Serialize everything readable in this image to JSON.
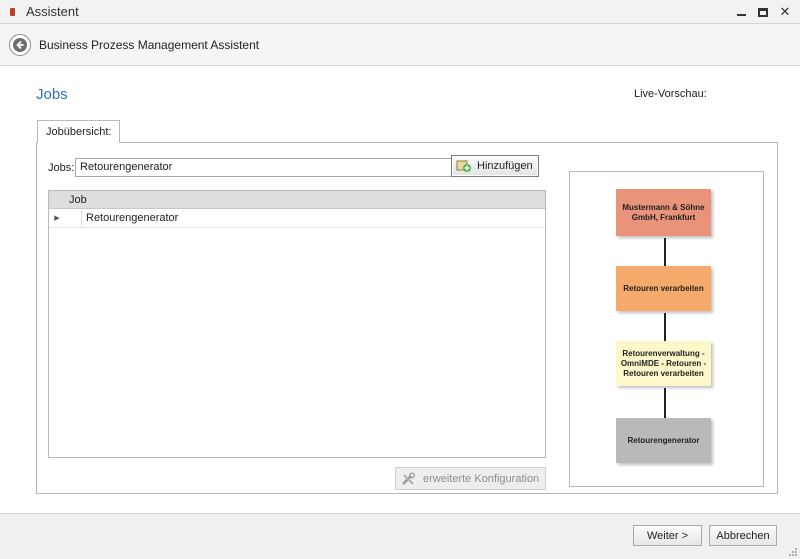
{
  "window": {
    "title": "Assistent"
  },
  "header": {
    "title": "Business Prozess Management Assistent"
  },
  "page": {
    "title": "Jobs"
  },
  "tabs": [
    {
      "label": "Jobübersicht:"
    }
  ],
  "jobs": {
    "label": "Jobs:",
    "selected": "Retourengenerator",
    "add_button": "Hinzufügen"
  },
  "grid": {
    "columns": [
      "Job"
    ],
    "rows": [
      {
        "job": "Retourengenerator"
      }
    ]
  },
  "config_button": "erweiterte Konfiguration",
  "preview": {
    "label": "Live-Vorschau:",
    "nodes": [
      {
        "text": "Mustermann & Söhne GmbH, Frankfurt",
        "color": "#e8937a"
      },
      {
        "text": "Retouren verarbeiten",
        "color": "#f5a96a"
      },
      {
        "text": "Retourenverwaltung - OmniMDE - Retouren - Retouren verarbeiten",
        "color": "#fdf7c9"
      },
      {
        "text": "Retourengenerator",
        "color": "#b9b9b9"
      }
    ]
  },
  "footer": {
    "next": "Weiter >",
    "cancel": "Abbrechen"
  }
}
